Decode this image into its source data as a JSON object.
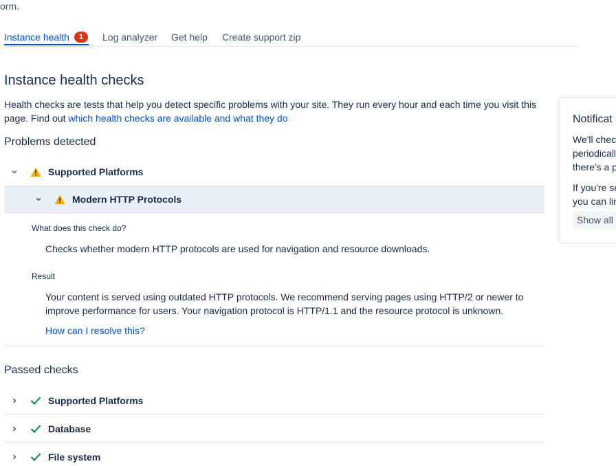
{
  "header": {
    "fragment_text": "orm."
  },
  "tabs": [
    {
      "label": "Instance health",
      "badge": "1",
      "active": true
    },
    {
      "label": "Log analyzer"
    },
    {
      "label": "Get help"
    },
    {
      "label": "Create support zip"
    }
  ],
  "main": {
    "title": "Instance health checks",
    "intro_text": "Health checks are tests that help you detect specific problems with your site. They run every hour and each time you visit this page. Find out ",
    "intro_link": "which health checks are available and what they do",
    "problems": {
      "title": "Problems detected",
      "group_label": "Supported Platforms",
      "item_label": "Modern HTTP Protocols",
      "what_label": "What does this check do?",
      "what_text": "Checks whether modern HTTP protocols are used for navigation and resource downloads.",
      "result_label": "Result",
      "result_text": "Your content is served using outdated HTTP protocols. We recommend serving pages using HTTP/2 or newer to improve performance for users. Your navigation protocol is HTTP/1.1 and the resource protocol is unknown.",
      "resolve_link": "How can I resolve this?"
    },
    "passed": {
      "title": "Passed checks",
      "items": [
        {
          "label": "Supported Platforms"
        },
        {
          "label": "Database"
        },
        {
          "label": "File system"
        }
      ]
    }
  },
  "side_panel": {
    "title": "Notificat",
    "lines": [
      "We'll chec",
      "periodicall",
      "there's a p",
      "If you're se",
      "you can lin"
    ],
    "button_label": "Show all r"
  },
  "colors": {
    "accent": "#0052cc",
    "warning": "#ffab00",
    "success": "#00875a",
    "badge": "#de350b",
    "highlight_row": "#e9f0f8"
  }
}
